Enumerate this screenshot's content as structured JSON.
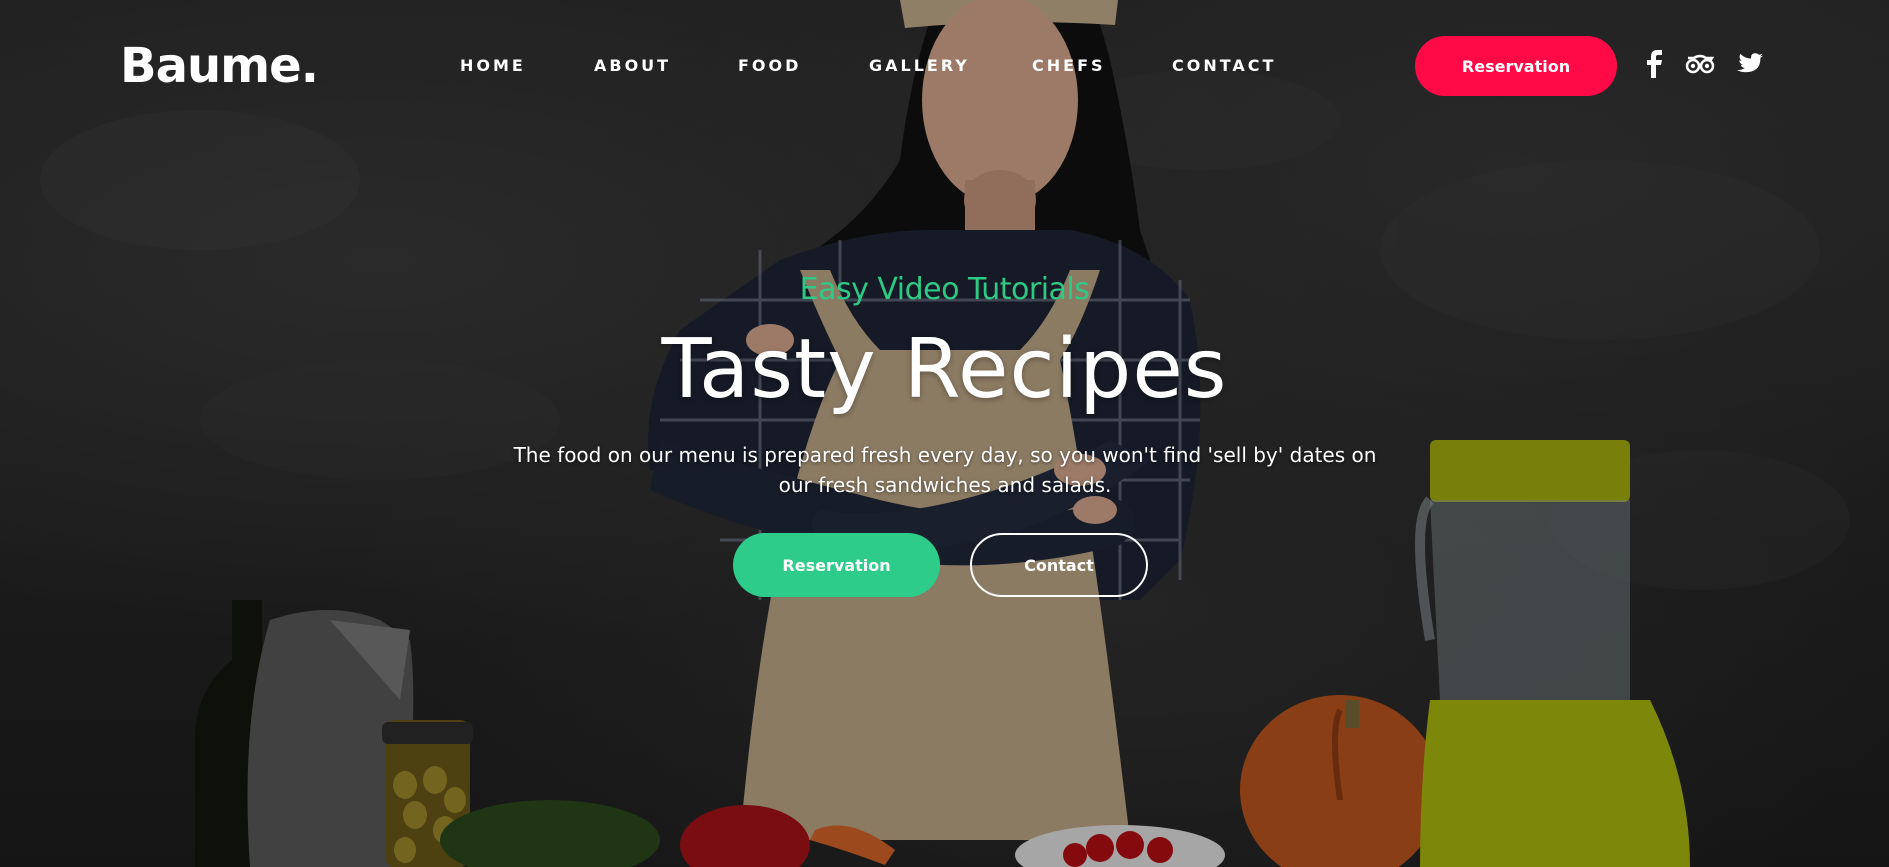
{
  "header": {
    "logo": "Baume.",
    "nav": [
      "HOME",
      "ABOUT",
      "FOOD",
      "GALLERY",
      "CHEFS",
      "CONTACT"
    ],
    "reservation_label": "Reservation",
    "social": [
      "facebook-icon",
      "tripadvisor-icon",
      "twitter-icon"
    ]
  },
  "hero": {
    "tagline": "Easy Video Tutorials",
    "title": "Tasty Recipes",
    "description": "The food on our menu is prepared fresh every day, so you won't find 'sell by' dates on our fresh sandwiches and salads.",
    "primary_button": "Reservation",
    "secondary_button": "Contact"
  },
  "colors": {
    "accent_red": "#ff0a47",
    "accent_green": "#2ecc8a",
    "tagline_green": "#2ec985",
    "text": "#ffffff"
  }
}
